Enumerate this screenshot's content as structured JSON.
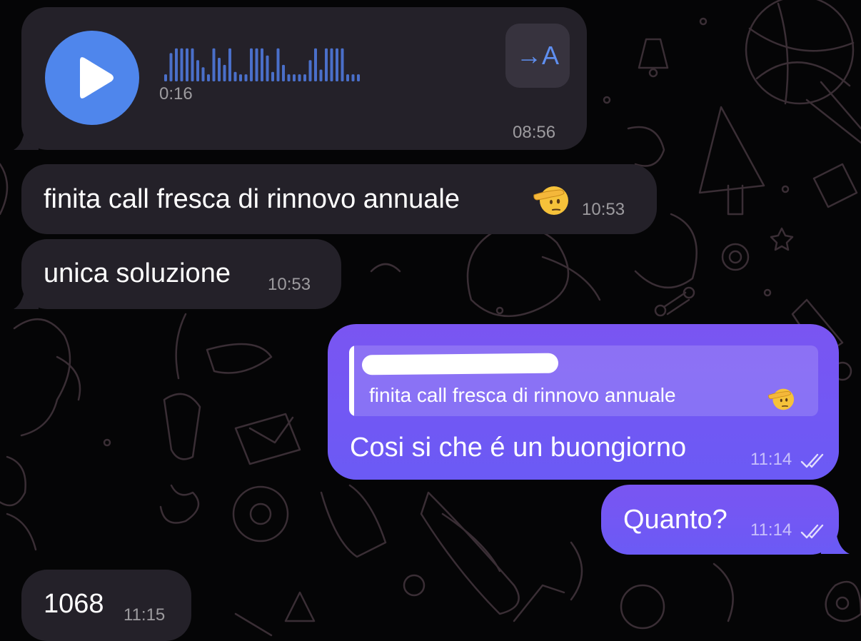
{
  "voice_message": {
    "duration": "0:16",
    "time": "08:56",
    "transcribe_label": "→A",
    "waveform": [
      3,
      12,
      14,
      14,
      14,
      14,
      9,
      6,
      3,
      14,
      10,
      7,
      14,
      4,
      3,
      3,
      14,
      14,
      14,
      11,
      4,
      14,
      7,
      3,
      3,
      3,
      3,
      9,
      14,
      5,
      14,
      14,
      14,
      14,
      3,
      3,
      3
    ]
  },
  "messages": [
    {
      "text": "finita call fresca di rinnovo annuale",
      "time": "10:53",
      "emoji": "saluting-face-emoji"
    },
    {
      "text": "unica soluzione",
      "time": "10:53"
    },
    {
      "text": "Cosi si che é un buongiorno",
      "time": "11:14",
      "reply_quote": "finita call fresca di rinnovo annuale",
      "reply_emoji": "saluting-face-emoji",
      "status": "read"
    },
    {
      "text": "Quanto?",
      "time": "11:14",
      "status": "read"
    },
    {
      "text": "1068",
      "time": "11:15"
    }
  ],
  "colors": {
    "incoming_bubble": "#242129",
    "outgoing_bubble": "#7a55f2",
    "accent_blue": "#4f86ec",
    "background": "#050506"
  }
}
